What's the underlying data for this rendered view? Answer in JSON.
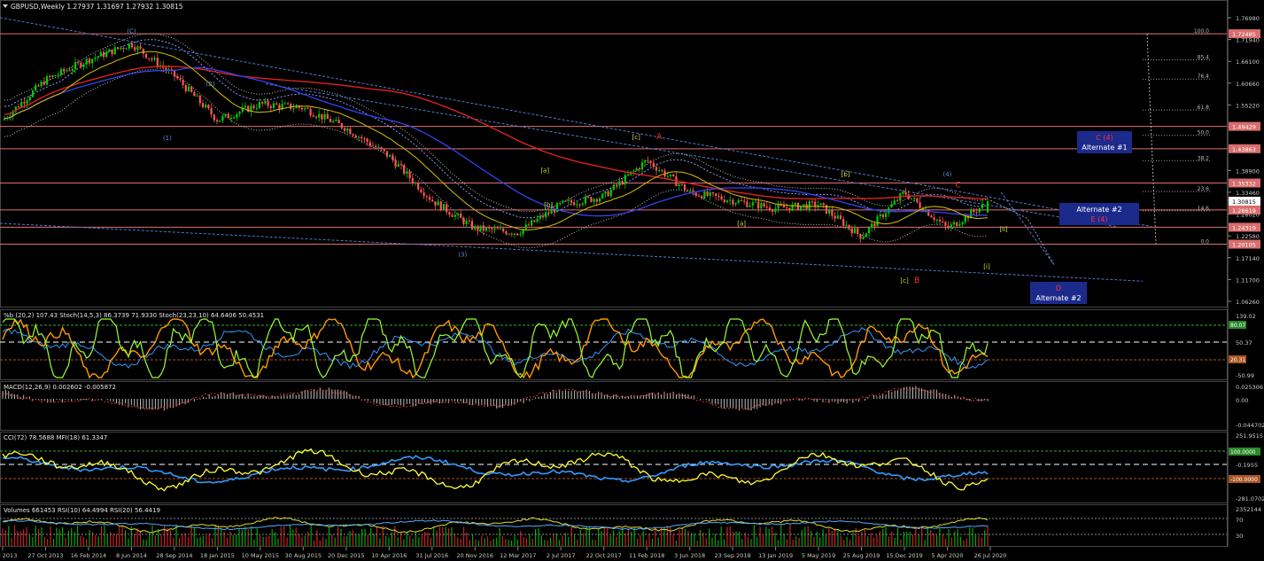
{
  "header": {
    "symbol_line": "GBPUSD,Weekly  1.27937 1.31697 1.27932 1.30815",
    "stoch_line": "%b (20,2) 107.43  Stoch(14,5,3) 86.3739 71.9330  Stoch(23,23,10) 64.6406 50.4531",
    "macd_line": "MACD(12,26,9) 0.002602 -0.005872",
    "cci_line": "CCI(72) 78.5688  MFI(18) 61.3347",
    "vol_line": "Volumes 661453  RSI(10) 64.4994  RSI(20) 56.4419"
  },
  "colors": {
    "background": "#000000",
    "bull": "#00cc00",
    "bear": "#ff5555",
    "axis_text": "#c8c8c8",
    "fib_line": "#e07070",
    "ma_red": "#dd2222",
    "ma_blue": "#3344ee",
    "ma_yellow": "#d8c000",
    "trend_blue": "#5577cc",
    "osc_green": "#99ff33",
    "osc_orange": "#ff9900",
    "osc_blue": "#3399ff",
    "label_box": "#1c2a8c"
  },
  "x_dates": [
    "7 Jul 2013",
    "27 Oct 2013",
    "16 Feb 2014",
    "8 Jun 2014",
    "28 Sep 2014",
    "18 Jan 2015",
    "10 May 2015",
    "30 Aug 2015",
    "20 Dec 2015",
    "10 Apr 2016",
    "31 Jul 2016",
    "20 Nov 2016",
    "12 Mar 2017",
    "2 Jul 2017",
    "22 Oct 2017",
    "11 Feb 2018",
    "3 Jun 2018",
    "23 Sep 2018",
    "13 Jan 2019",
    "5 May 2019",
    "25 Aug 2019",
    "15 Dec 2019",
    "5 Apr 2020",
    "26 Jul 2020"
  ],
  "chart_data": {
    "type": "candlestick",
    "symbol": "GBPUSD",
    "timeframe": "Weekly",
    "ohlc_last": {
      "open": 1.27937,
      "high": 1.31697,
      "low": 1.27932,
      "close": 1.30815
    },
    "ylim": [
      1.05,
      1.8
    ],
    "y_ticks": [
      "1.76980",
      "1.71940",
      "1.66100",
      "1.60660",
      "1.55220",
      "1.49780",
      "1.44340",
      "1.38900",
      "1.33460",
      "1.28020",
      "1.22580",
      "1.17140",
      "1.11700",
      "1.06260"
    ],
    "price_key_points": [
      [
        "7 Jul 2013",
        1.51
      ],
      [
        "27 Oct 2013",
        1.61
      ],
      [
        "16 Feb 2014",
        1.66
      ],
      [
        "8 Jun 2014",
        1.7
      ],
      [
        "28 Sep 2014",
        1.62
      ],
      [
        "18 Jan 2015",
        1.51
      ],
      [
        "10 May 2015",
        1.55
      ],
      [
        "30 Aug 2015",
        1.54
      ],
      [
        "20 Dec 2015",
        1.49
      ],
      [
        "10 Apr 2016",
        1.42
      ],
      [
        "31 Jul 2016",
        1.31
      ],
      [
        "20 Nov 2016",
        1.24
      ],
      [
        "12 Mar 2017",
        1.23
      ],
      [
        "2 Jul 2017",
        1.3
      ],
      [
        "22 Oct 2017",
        1.32
      ],
      [
        "11 Feb 2018",
        1.41
      ],
      [
        "3 Jun 2018",
        1.33
      ],
      [
        "23 Sep 2018",
        1.31
      ],
      [
        "13 Jan 2019",
        1.29
      ],
      [
        "5 May 2019",
        1.3
      ],
      [
        "25 Aug 2019",
        1.22
      ],
      [
        "15 Dec 2019",
        1.33
      ],
      [
        "5 Apr 2020",
        1.24
      ],
      [
        "26 Jul 2020",
        1.308
      ]
    ],
    "horizontal_levels": [
      {
        "value": 1.72485,
        "label": "1.72485"
      },
      {
        "value": 1.49429,
        "label": "1.49429"
      },
      {
        "value": 1.43863,
        "label": "1.43863"
      },
      {
        "value": 1.35332,
        "label": "1.35332"
      },
      {
        "value": 1.28619,
        "label": "1.28619"
      },
      {
        "value": 1.24319,
        "label": "1.24319"
      },
      {
        "value": 1.20105,
        "label": "1.20105"
      }
    ],
    "current_price_label": "1.30815",
    "fib_levels": [
      {
        "label": "100.0",
        "value": 1.72485
      },
      {
        "label": "85.4",
        "value": 1.66
      },
      {
        "label": "76.4",
        "value": 1.612
      },
      {
        "label": "61.8",
        "value": 1.535
      },
      {
        "label": "50.0",
        "value": 1.472
      },
      {
        "label": "38.2",
        "value": 1.409
      },
      {
        "label": "23.6",
        "value": 1.332
      },
      {
        "label": "14.6",
        "value": 1.284
      },
      {
        "label": "0.0",
        "value": 1.20105
      }
    ],
    "wave_labels": [
      {
        "text": "(C)",
        "date": "8 Jun 2014",
        "value": 1.726,
        "color": "#5b8fdd"
      },
      {
        "text": "(1)",
        "date": "28 Sep 2014",
        "value": 1.46,
        "color": "#5b8fdd"
      },
      {
        "text": "(2)",
        "date": "18 Jan 2015",
        "value": 1.595,
        "color": "#5b8fdd"
      },
      {
        "text": "(3)",
        "date": "20 Nov 2016",
        "value": 1.17,
        "color": "#5b8fdd"
      },
      {
        "text": "[a]",
        "date": "2 Jul 2017",
        "value": 1.38,
        "color": "#dddd44"
      },
      {
        "text": "[b]",
        "date": "2 Jul 2017",
        "value": 1.294,
        "color": "#dddd44"
      },
      {
        "text": "[c]",
        "date": "11 Feb 2018",
        "value": 1.463,
        "color": "#dddd44"
      },
      {
        "text": "A",
        "date": "11 Feb 2018",
        "value": 1.463,
        "color": "#ff3333"
      },
      {
        "text": "[a]",
        "date": "23 Sep 2018",
        "value": 1.247,
        "color": "#dddd44"
      },
      {
        "text": "[b]",
        "date": "25 Aug 2019",
        "value": 1.37,
        "color": "#dddd44"
      },
      {
        "text": "(4)",
        "date": "5 Apr 2020",
        "value": 1.37,
        "color": "#5b8fdd"
      },
      {
        "text": "C",
        "date": "5 Apr 2020",
        "value": 1.342,
        "color": "#ff3333"
      },
      {
        "text": "[c]",
        "date": "15 Dec 2019",
        "value": 1.105,
        "color": "#dddd44"
      },
      {
        "text": "B",
        "date": "15 Dec 2019",
        "value": 1.105,
        "color": "#ff3333"
      },
      {
        "text": "[ii]",
        "date": "26 Jul 2020",
        "value": 1.233,
        "color": "#dddd44"
      },
      {
        "text": "[i]",
        "date": "26 Jul 2020",
        "value": 1.14,
        "color": "#dddd44"
      }
    ],
    "alternate_boxes": [
      {
        "line1": "C (4)",
        "line2": "Alternate #1",
        "line1_color": "#ff3333"
      },
      {
        "line1": "Alternate #2",
        "line2": "E (4)",
        "line2_color": "#ff3333"
      },
      {
        "line1": "D",
        "line2": "Alternate #2",
        "line1_color": "#ff3333"
      }
    ],
    "panels": [
      {
        "name": "%b / Stochastic",
        "y_ticks": [
          "139.02",
          "80",
          "50.37",
          "20",
          "-50.99"
        ],
        "highlight_labels": [
          "80.07",
          "20.31"
        ]
      },
      {
        "name": "MACD",
        "y_ticks": [
          "0.025306",
          "0.00",
          "-0.044702"
        ]
      },
      {
        "name": "CCI / MFI",
        "y_ticks": [
          "251.9515",
          "-0.1955",
          "-281.0702"
        ],
        "highlight_labels": [
          "100.0000",
          "-100.0000"
        ]
      },
      {
        "name": "Volumes / RSI",
        "y_ticks": [
          "2352144",
          "70",
          "30"
        ]
      }
    ]
  }
}
